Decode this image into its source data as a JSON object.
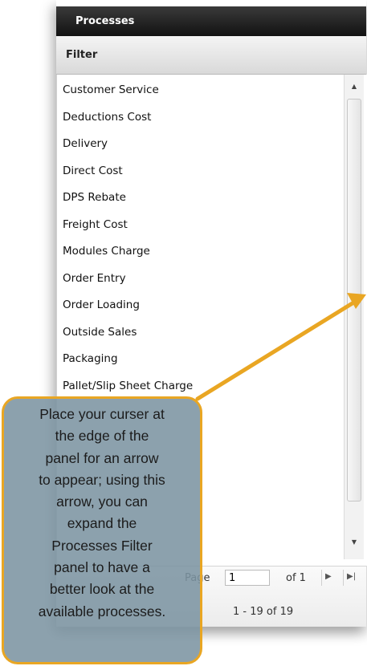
{
  "panel": {
    "title": "Processes",
    "filter_label": "Filter"
  },
  "list": {
    "items": [
      "Customer Service",
      "Deductions Cost",
      "Delivery",
      "Direct Cost",
      "DPS Rebate",
      "Freight Cost",
      "Modules Charge",
      "Order Entry",
      "Order Loading",
      "Outside Sales",
      "Packaging",
      "Pallet/Slip Sheet Charge"
    ]
  },
  "pager": {
    "page_label": "Page",
    "page_value": "1",
    "of_label": "of 1",
    "display_text": "1 - 19 of 19"
  },
  "callout": {
    "lines": [
      "Place your curser at",
      "the edge of the",
      "panel for an arrow",
      "to appear; using this",
      "arrow, you can",
      "expand the",
      "Processes Filter",
      "panel to have a",
      "better look at the",
      "available processes."
    ]
  },
  "colors": {
    "accent": "#e9a623",
    "title_bar": "#1a1a1a",
    "callout_fill": "#7c94a2"
  },
  "icons": {
    "scroll_up": "chevron-up-icon",
    "scroll_down": "chevron-down-icon",
    "next_page": "next-page-icon",
    "last_page": "last-page-icon"
  }
}
